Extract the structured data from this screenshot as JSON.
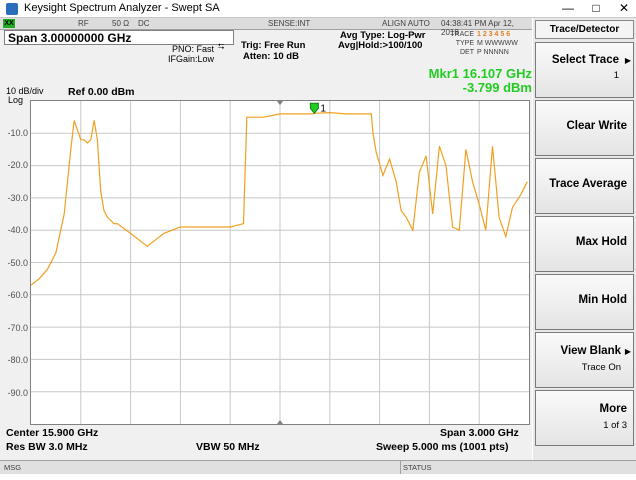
{
  "window": {
    "title": "Keysight Spectrum Analyzer - Swept SA",
    "min": "—",
    "max": "□",
    "close": "✕"
  },
  "statusbar": {
    "rf": "RF",
    "imp": "50 Ω",
    "coupling": "DC",
    "sense": "SENSE:INT",
    "align": "ALIGN AUTO",
    "datetime": "04:38:41 PM Apr 12, 2018"
  },
  "header": {
    "span": "Span 3.00000000 GHz",
    "pno": "PNO: Fast",
    "ifgain": "IFGain:Low",
    "trig": "Trig: Free Run",
    "atten": "Atten: 10 dB",
    "avg_type": "Avg Type: Log-Pwr",
    "avg_hold": "Avg|Hold:>100/100",
    "trace_row": "1 2 3 4 5 6",
    "type_label": "TYPE",
    "type_row": "M WWWWW",
    "det_label": "DET",
    "det_row": "P NNNNN",
    "trace_label": "TRACE"
  },
  "marker": {
    "freq": "Mkr1 16.107 GHz",
    "amp": "-3.799 dBm",
    "label": "1"
  },
  "scale": {
    "per_div": "10 dB/div",
    "log": "Log",
    "ref": "Ref 0.00 dBm",
    "ticks": [
      "-10.0",
      "-20.0",
      "-30.0",
      "-40.0",
      "-50.0",
      "-60.0",
      "-70.0",
      "-80.0",
      "-90.0"
    ]
  },
  "footer": {
    "center": "Center 15.900 GHz",
    "span": "Span 3.000 GHz",
    "rbw": "Res BW 3.0 MHz",
    "vbw": "VBW 50 MHz",
    "sweep": "Sweep  5.000 ms (1001 pts)"
  },
  "msgbar": {
    "msg": "MSG",
    "status": "STATUS"
  },
  "softkeys": {
    "title": "Trace/Detector",
    "keys": [
      {
        "label": "Select Trace",
        "sub": "1"
      },
      {
        "label": "Clear Write",
        "sub": ""
      },
      {
        "label": "Trace Average",
        "sub": ""
      },
      {
        "label": "Max Hold",
        "sub": ""
      },
      {
        "label": "Min Hold",
        "sub": ""
      },
      {
        "label": "View Blank",
        "sub": "Trace On"
      },
      {
        "label": "More",
        "sub": "1 of 3"
      }
    ]
  },
  "chart_data": {
    "type": "line",
    "xlabel": "",
    "ylabel": "",
    "xlim": [
      14.4,
      17.4
    ],
    "ylim": [
      -100,
      0
    ],
    "x_unit": "GHz",
    "y_unit": "dBm",
    "grid": true,
    "trace_color": "#f0a020",
    "series": [
      {
        "x": [
          14.4,
          14.45,
          14.5,
          14.55,
          14.6,
          14.64,
          14.66,
          14.68,
          14.7,
          14.72,
          14.74,
          14.76,
          14.78,
          14.8,
          14.82,
          14.84,
          14.86,
          14.88,
          14.9,
          14.92,
          15.0,
          15.1,
          15.2,
          15.25,
          15.3,
          15.35,
          15.4,
          15.5,
          15.6,
          15.68,
          15.7,
          15.72,
          15.8,
          15.9,
          16.0,
          16.1,
          16.107,
          16.2,
          16.3,
          16.4,
          16.45,
          16.46,
          16.48,
          16.52,
          16.56,
          16.6,
          16.63,
          16.66,
          16.7,
          16.74,
          16.78,
          16.82,
          16.86,
          16.9,
          16.94,
          16.98,
          17.02,
          17.06,
          17.1,
          17.14,
          17.18,
          17.22,
          17.26,
          17.3,
          17.35,
          17.39
        ],
        "y": [
          -57,
          -55,
          -52,
          -47,
          -35,
          -15,
          -6,
          -9,
          -12,
          -12,
          -13,
          -12,
          -6,
          -12,
          -28,
          -34,
          -36,
          -37,
          -38,
          -38,
          -41,
          -45,
          -41,
          -40,
          -39,
          -39,
          -39,
          -39,
          -39,
          -38,
          -5,
          -5,
          -5,
          -4,
          -4,
          -4,
          -3.8,
          -3.6,
          -4,
          -4,
          -4,
          -10,
          -16,
          -23,
          -18,
          -25,
          -34,
          -36,
          -40,
          -22,
          -17,
          -35,
          -14,
          -20,
          -39,
          -40,
          -15,
          -25,
          -32,
          -40,
          -14,
          -36,
          -42,
          -33,
          -29,
          -25
        ]
      }
    ]
  }
}
